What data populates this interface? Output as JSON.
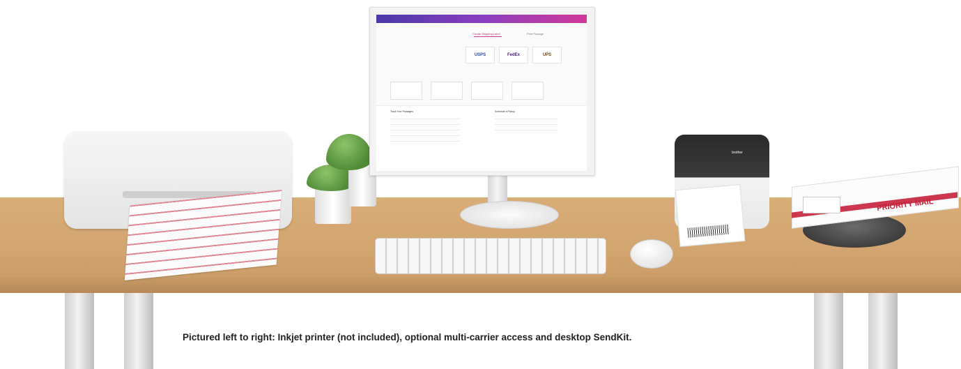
{
  "caption": "Pictured left to right: Inkjet printer (not included), optional multi-carrier access and desktop SendKit.",
  "screen": {
    "tabs": [
      "Create Shipping Label",
      "Print Postage"
    ],
    "carriers": [
      "USPS",
      "FedEx",
      "UPS"
    ],
    "sections": [
      "Track Your Packages",
      "Schedule a Pickup"
    ]
  },
  "devices": {
    "label_printer_brand": "brother",
    "box_text": "PRIORITY MAIL"
  },
  "colors": {
    "desk": "#d4a872",
    "nav_gradient_start": "#4a3aa8",
    "nav_gradient_end": "#d23a9a",
    "priority_red": "#c8213a"
  }
}
